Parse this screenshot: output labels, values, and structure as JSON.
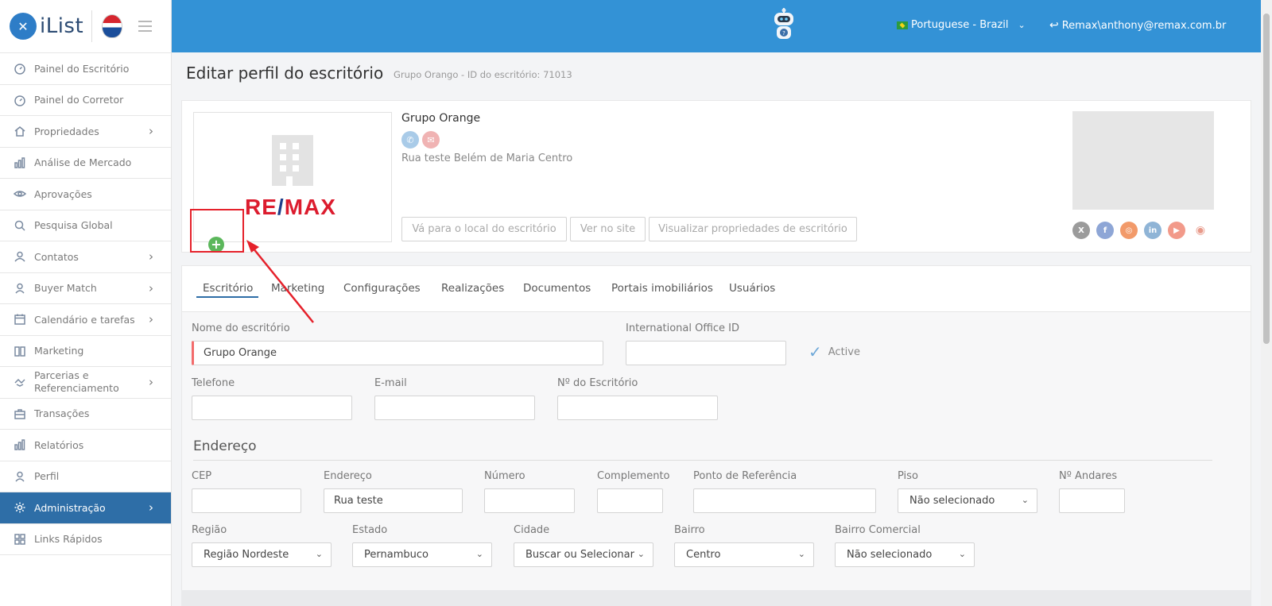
{
  "brand": {
    "name": "iList"
  },
  "sidebar": {
    "items": [
      {
        "label": "Painel do Escritório",
        "icon": "gauge-icon",
        "chevron": false
      },
      {
        "label": "Painel do Corretor",
        "icon": "gauge-icon",
        "chevron": false
      },
      {
        "label": "Propriedades",
        "icon": "home-icon",
        "chevron": true
      },
      {
        "label": "Análise de Mercado",
        "icon": "bar-chart-icon",
        "chevron": false
      },
      {
        "label": "Aprovações",
        "icon": "eye-icon",
        "chevron": false
      },
      {
        "label": "Pesquisa Global",
        "icon": "search-icon",
        "chevron": false
      },
      {
        "label": "Contatos",
        "icon": "contacts-icon",
        "chevron": true
      },
      {
        "label": "Buyer Match",
        "icon": "user-icon",
        "chevron": true
      },
      {
        "label": "Calendário e tarefas",
        "icon": "calendar-icon",
        "chevron": true
      },
      {
        "label": "Marketing",
        "icon": "book-icon",
        "chevron": false
      },
      {
        "label": "Parcerias e Referenciamento",
        "icon": "handshake-icon",
        "chevron": true
      },
      {
        "label": "Transações",
        "icon": "briefcase-icon",
        "chevron": false
      },
      {
        "label": "Relatórios",
        "icon": "bar-chart-icon",
        "chevron": false
      },
      {
        "label": "Perfil",
        "icon": "user-icon",
        "chevron": false
      },
      {
        "label": "Administração",
        "icon": "gear-icon",
        "chevron": true,
        "active": true
      },
      {
        "label": "Links Rápidos",
        "icon": "links-icon",
        "chevron": false
      }
    ]
  },
  "header": {
    "language": "Portuguese - Brazil",
    "user": "Remax\\anthony@remax.com.br"
  },
  "page": {
    "title": "Editar perfil do escritório",
    "subtitle": "Grupo Orango - ID do escritório: 71013"
  },
  "profile": {
    "name": "Grupo Orange",
    "address": "Rua teste Belém de Maria Centro",
    "logo_text_left": "RE",
    "logo_text_slash": "/",
    "logo_text_right": "MAX",
    "add_symbol": "+",
    "buttons": {
      "go_to_location": "Vá para o local do escritório",
      "view_on_site": "Ver no site",
      "view_properties": "Visualizar propriedades de escritório"
    },
    "socials": [
      "x-icon",
      "facebook-icon",
      "instagram-icon",
      "linkedin-icon",
      "youtube-icon",
      "weibo-icon"
    ]
  },
  "tabs": [
    "Escritório",
    "Marketing",
    "Configurações",
    "Realizações",
    "Documentos",
    "Portais imobiliários",
    "Usuários"
  ],
  "form": {
    "office_name_label": "Nome do escritório",
    "office_name_value": "Grupo Orange",
    "intl_id_label": "International Office ID",
    "intl_id_value": "",
    "active_label": "Active",
    "phone_label": "Telefone",
    "email_label": "E-mail",
    "office_no_label": "Nº do Escritório",
    "address_section": "Endereço",
    "cep_label": "CEP",
    "endereco_label": "Endereço",
    "endereco_value": "Rua teste",
    "numero_label": "Número",
    "complemento_label": "Complemento",
    "referencia_label": "Ponto de Referência",
    "piso_label": "Piso",
    "piso_value": "Não selecionado",
    "andares_label": "Nº Andares",
    "regiao_label": "Região",
    "regiao_value": "Região Nordeste",
    "estado_label": "Estado",
    "estado_value": "Pernambuco",
    "cidade_label": "Cidade",
    "cidade_value": "Buscar ou Selecionar",
    "bairro_label": "Bairro",
    "bairro_value": "Centro",
    "bairro_com_label": "Bairro Comercial",
    "bairro_com_value": "Não selecionado"
  },
  "colors": {
    "header_blue": "#3392d6",
    "active_nav": "#2e6ea7",
    "annotation_red": "#e5212b",
    "add_green": "#5bb75b"
  }
}
